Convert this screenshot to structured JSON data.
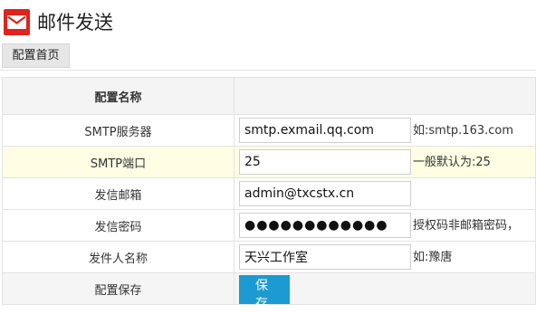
{
  "header": {
    "title": "邮件发送",
    "icon": "mail-icon",
    "icon_color": "#e0231c"
  },
  "nav": {
    "tab_label": "配置首页"
  },
  "table": {
    "header_label": "配置名称",
    "rows": [
      {
        "label": "SMTP服务器",
        "value": "smtp.exmail.qq.com",
        "hint": "如:smtp.163.com"
      },
      {
        "label": "SMTP端口",
        "value": "25",
        "hint": "一般默认为:25"
      },
      {
        "label": "发信邮箱",
        "value": "admin@txcstx.cn",
        "hint": ""
      },
      {
        "label": "发信密码",
        "value": "●●●●●●●●●●●●",
        "hint": "授权码非邮箱密码，"
      },
      {
        "label": "发件人名称",
        "value": "天兴工作室",
        "hint": "如:豫唐"
      }
    ],
    "save_label": "配置保存",
    "save_button": "保存"
  },
  "colors": {
    "accent": "#1b9bd1",
    "highlight_row": "#fffee4"
  }
}
